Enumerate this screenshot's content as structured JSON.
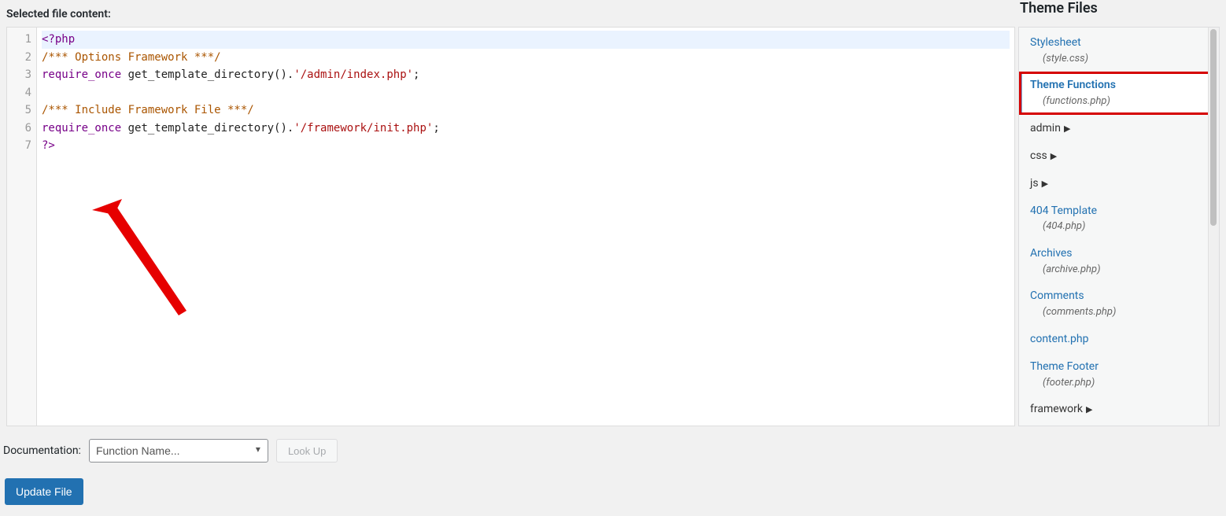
{
  "labels": {
    "selected_file_content": "Selected file content:",
    "theme_files": "Theme Files",
    "documentation": "Documentation:",
    "function_name_placeholder": "Function Name...",
    "lookup": "Look Up",
    "update_file": "Update File"
  },
  "code": {
    "lines": [
      {
        "n": "1",
        "parts": [
          {
            "t": "<?php",
            "c": "tk-keyword"
          }
        ]
      },
      {
        "n": "2",
        "parts": [
          {
            "t": "/*** Options Framework ***/",
            "c": "tk-comment"
          }
        ]
      },
      {
        "n": "3",
        "parts": [
          {
            "t": "require_once",
            "c": "tk-keyword"
          },
          {
            "t": " ",
            "c": ""
          },
          {
            "t": "get_template_directory",
            "c": "tk-func"
          },
          {
            "t": "().",
            "c": "tk-punct"
          },
          {
            "t": "'/admin/index.php'",
            "c": "tk-str"
          },
          {
            "t": ";",
            "c": "tk-punct"
          }
        ]
      },
      {
        "n": "4",
        "parts": []
      },
      {
        "n": "5",
        "parts": [
          {
            "t": "/*** Include Framework File ***/",
            "c": "tk-comment"
          }
        ]
      },
      {
        "n": "6",
        "parts": [
          {
            "t": "require_once",
            "c": "tk-keyword"
          },
          {
            "t": " ",
            "c": ""
          },
          {
            "t": "get_template_directory",
            "c": "tk-func"
          },
          {
            "t": "().",
            "c": "tk-punct"
          },
          {
            "t": "'/framework/init.php'",
            "c": "tk-str"
          },
          {
            "t": ";",
            "c": "tk-punct"
          }
        ]
      },
      {
        "n": "7",
        "parts": [
          {
            "t": "?>",
            "c": "tk-keyword"
          }
        ]
      }
    ]
  },
  "theme_files": [
    {
      "name": "Stylesheet",
      "sub": "(style.css)",
      "type": "file"
    },
    {
      "name": "Theme Functions",
      "sub": "(functions.php)",
      "type": "file",
      "selected": true,
      "highlighted": true
    },
    {
      "name": "admin",
      "type": "folder"
    },
    {
      "name": "css",
      "type": "folder"
    },
    {
      "name": "js",
      "type": "folder"
    },
    {
      "name": "404 Template",
      "sub": "(404.php)",
      "type": "file"
    },
    {
      "name": "Archives",
      "sub": "(archive.php)",
      "type": "file"
    },
    {
      "name": "Comments",
      "sub": "(comments.php)",
      "type": "file"
    },
    {
      "name": "content.php",
      "type": "simple"
    },
    {
      "name": "Theme Footer",
      "sub": "(footer.php)",
      "type": "file"
    },
    {
      "name": "framework",
      "type": "folder"
    }
  ]
}
